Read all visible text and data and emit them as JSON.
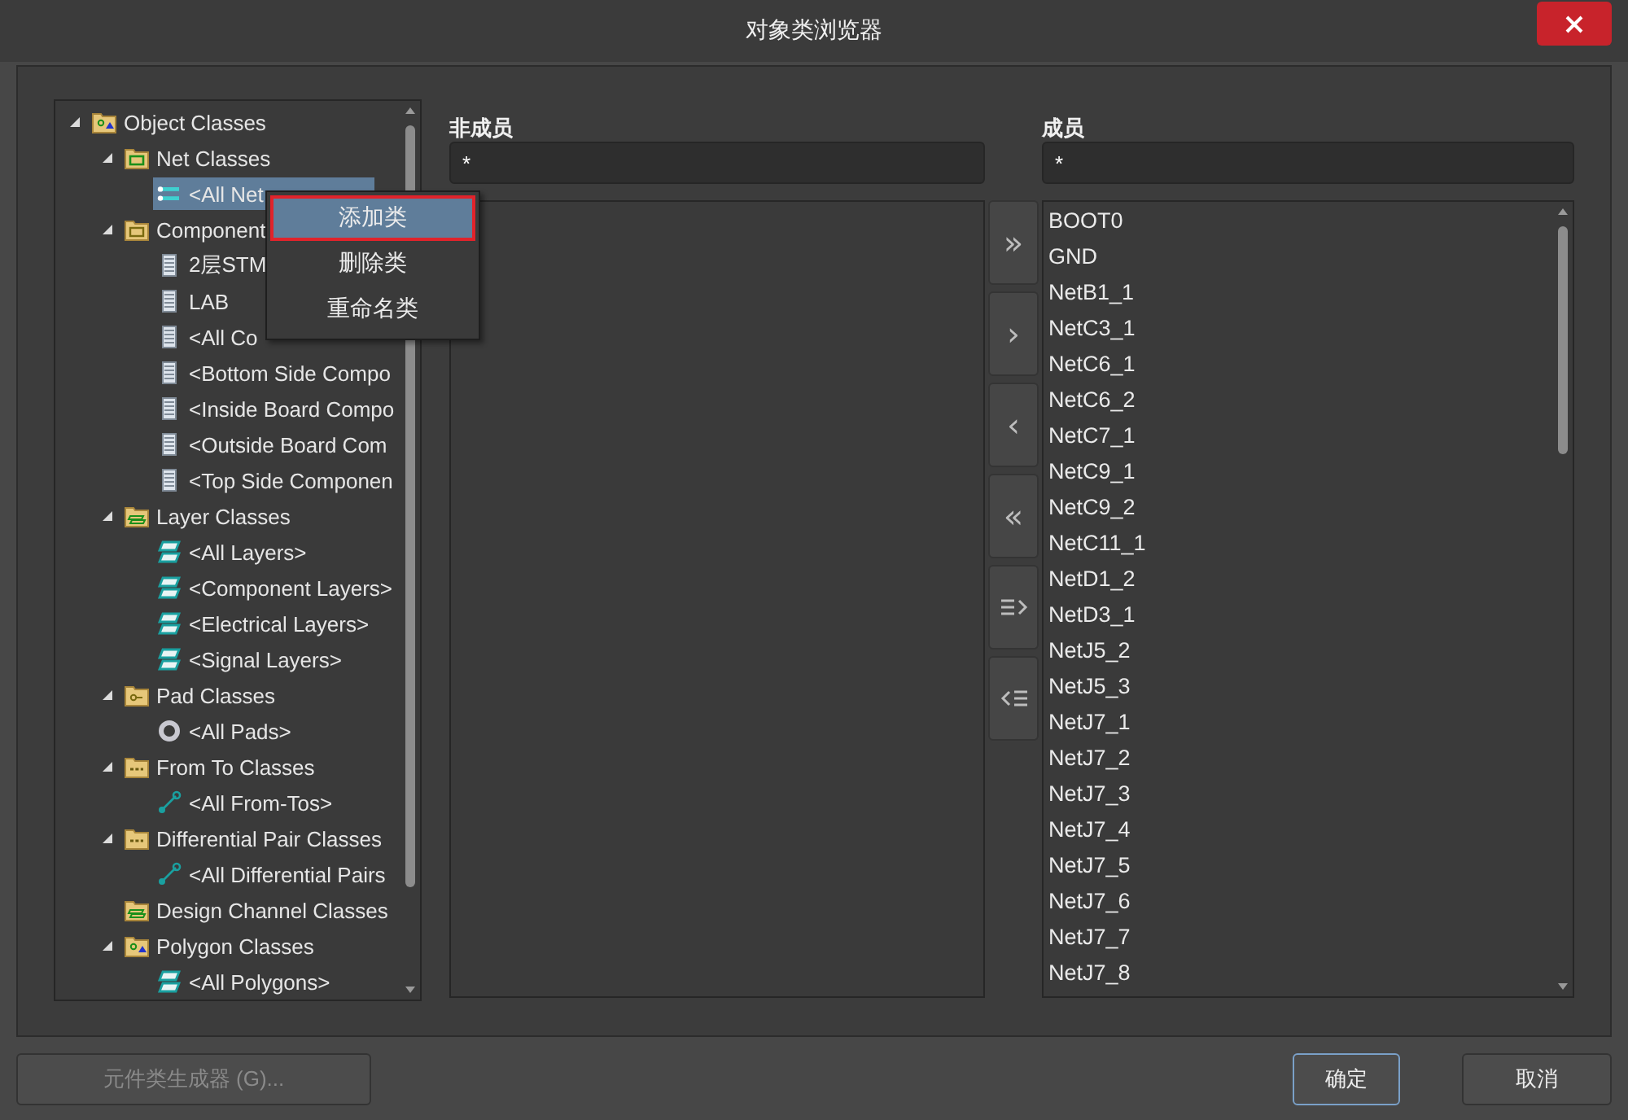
{
  "window": {
    "title": "对象类浏览器"
  },
  "tree": [
    {
      "label": "Object Classes",
      "kind": "object-folder",
      "expanded": true,
      "selected": false,
      "children": [
        {
          "label": "Net Classes",
          "kind": "net-folder",
          "expanded": true,
          "selected": false,
          "children": [
            {
              "label": "<All Net",
              "kind": "net",
              "selected": true
            }
          ]
        },
        {
          "label": "Component",
          "kind": "component-folder",
          "expanded": true,
          "selected": false,
          "children": [
            {
              "label": "2层STM",
              "kind": "component",
              "selected": false
            },
            {
              "label": "LAB",
              "kind": "component",
              "selected": false
            },
            {
              "label": "<All Co",
              "kind": "component",
              "selected": false
            },
            {
              "label": "<Bottom Side Compo",
              "kind": "component",
              "selected": false
            },
            {
              "label": "<Inside Board Compo",
              "kind": "component",
              "selected": false
            },
            {
              "label": "<Outside Board Com",
              "kind": "component",
              "selected": false
            },
            {
              "label": "<Top Side Componen",
              "kind": "component",
              "selected": false
            }
          ]
        },
        {
          "label": "Layer Classes",
          "kind": "layer-folder",
          "expanded": true,
          "selected": false,
          "children": [
            {
              "label": "<All Layers>",
              "kind": "layer",
              "selected": false
            },
            {
              "label": "<Component Layers>",
              "kind": "layer",
              "selected": false
            },
            {
              "label": "<Electrical Layers>",
              "kind": "layer",
              "selected": false
            },
            {
              "label": "<Signal Layers>",
              "kind": "layer",
              "selected": false
            }
          ]
        },
        {
          "label": "Pad Classes",
          "kind": "pad-folder",
          "expanded": true,
          "selected": false,
          "children": [
            {
              "label": "<All Pads>",
              "kind": "pad",
              "selected": false
            }
          ]
        },
        {
          "label": "From To Classes",
          "kind": "fromto-folder",
          "expanded": true,
          "selected": false,
          "children": [
            {
              "label": "<All From-Tos>",
              "kind": "fromto",
              "selected": false
            }
          ]
        },
        {
          "label": "Differential Pair Classes",
          "kind": "fromto-folder",
          "expanded": true,
          "selected": false,
          "children": [
            {
              "label": "<All Differential Pairs",
              "kind": "fromto",
              "selected": false
            }
          ]
        },
        {
          "label": "Design Channel Classes",
          "kind": "layer-folder",
          "selected": false
        },
        {
          "label": "Polygon Classes",
          "kind": "object-folder",
          "expanded": true,
          "selected": false,
          "children": [
            {
              "label": "<All Polygons>",
              "kind": "layer",
              "selected": false
            }
          ]
        }
      ]
    }
  ],
  "context_menu": [
    {
      "label": "添加类",
      "selected": true
    },
    {
      "label": "删除类",
      "selected": false
    },
    {
      "label": "重命名类",
      "selected": false
    }
  ],
  "non_members": {
    "label": "非成员",
    "filter": "*"
  },
  "move_buttons": [
    {
      "kind": "all-right",
      "text": "»"
    },
    {
      "kind": "right",
      "text": "›"
    },
    {
      "kind": "left",
      "text": "‹"
    },
    {
      "kind": "all-left",
      "text": "«"
    },
    {
      "kind": "list-right"
    },
    {
      "kind": "list-left"
    }
  ],
  "members": {
    "label": "成员",
    "filter": "*",
    "items": [
      "BOOT0",
      "GND",
      "NetB1_1",
      "NetC3_1",
      "NetC6_1",
      "NetC6_2",
      "NetC7_1",
      "NetC9_1",
      "NetC9_2",
      "NetC11_1",
      "NetD1_2",
      "NetD3_1",
      "NetJ5_2",
      "NetJ5_3",
      "NetJ7_1",
      "NetJ7_2",
      "NetJ7_3",
      "NetJ7_4",
      "NetJ7_5",
      "NetJ7_6",
      "NetJ7_7",
      "NetJ7_8"
    ]
  },
  "footer": {
    "generator_button": {
      "label": "元件类生成器 (G)...",
      "disabled": true
    },
    "ok_button": {
      "label": "确定",
      "default": true
    },
    "cancel_button": {
      "label": "取消",
      "default": false
    }
  }
}
